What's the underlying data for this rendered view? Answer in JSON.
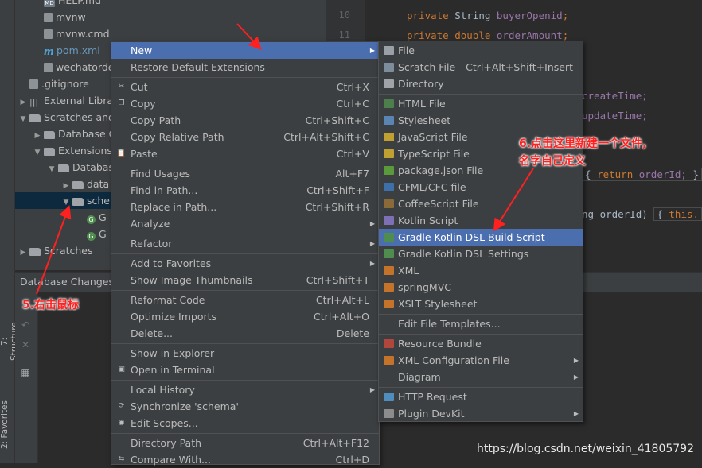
{
  "project_tree": [
    {
      "label": "HELP.md",
      "icon": "md",
      "indent": 1,
      "twisty": ""
    },
    {
      "label": "mvnw",
      "icon": "file",
      "indent": 1,
      "twisty": ""
    },
    {
      "label": "mvnw.cmd",
      "icon": "file",
      "indent": 1,
      "twisty": ""
    },
    {
      "label": "pom.xml",
      "icon": "m",
      "indent": 1,
      "twisty": "",
      "blue": true
    },
    {
      "label": "wechatorde",
      "icon": "file",
      "indent": 1,
      "twisty": ""
    },
    {
      "label": ".gitignore",
      "icon": "file",
      "indent": 0,
      "twisty": ""
    },
    {
      "label": "External Librar",
      "icon": "lib",
      "indent": 0,
      "twisty": "▶"
    },
    {
      "label": "Scratches and",
      "icon": "folder",
      "indent": 0,
      "twisty": "▼"
    },
    {
      "label": "Database C",
      "icon": "folder",
      "indent": 1,
      "twisty": "▶"
    },
    {
      "label": "Extensions",
      "icon": "folder",
      "indent": 1,
      "twisty": "▼"
    },
    {
      "label": "Databas",
      "icon": "folder",
      "indent": 2,
      "twisty": "▼"
    },
    {
      "label": "data",
      "icon": "folder",
      "indent": 3,
      "twisty": "▶"
    },
    {
      "label": "schen",
      "icon": "folder",
      "indent": 3,
      "twisty": "▼",
      "selected": true
    },
    {
      "label": "G",
      "icon": "g",
      "indent": 4,
      "twisty": ""
    },
    {
      "label": "G",
      "icon": "g",
      "indent": 4,
      "twisty": ""
    },
    {
      "label": "Scratches",
      "icon": "folder",
      "indent": 0,
      "twisty": "▶"
    }
  ],
  "side_tabs": {
    "structure": "7: Structure",
    "favorites": "2: Favorites"
  },
  "database_changes_label": "Database Changes",
  "line_numbers": [
    "10",
    "11"
  ],
  "code": {
    "private": "private",
    "string_type": "String",
    "double_type": "double",
    "buyer_openid": "buyerOpenid",
    "order_amount": "orderAmount",
    "create_time": "createTime;",
    "update_time": "updateTime;",
    "return_kw": "return",
    "order_id": "orderId;",
    "ng_order_id": "ng orderId)",
    "this_kw": "this."
  },
  "context_menu": [
    {
      "label": "New",
      "shortcut": "",
      "arrow": true,
      "hl": true,
      "icon": ""
    },
    {
      "label": "Restore Default Extensions",
      "shortcut": "",
      "icon": ""
    },
    {
      "sep": true
    },
    {
      "label": "Cut",
      "shortcut": "Ctrl+X",
      "icon": "scissors-icon"
    },
    {
      "label": "Copy",
      "shortcut": "Ctrl+C",
      "icon": "copy-icon"
    },
    {
      "label": "Copy Path",
      "shortcut": "Ctrl+Shift+C",
      "icon": ""
    },
    {
      "label": "Copy Relative Path",
      "shortcut": "Ctrl+Alt+Shift+C",
      "icon": ""
    },
    {
      "label": "Paste",
      "shortcut": "Ctrl+V",
      "icon": "paste-icon"
    },
    {
      "sep": true
    },
    {
      "label": "Find Usages",
      "shortcut": "Alt+F7",
      "icon": ""
    },
    {
      "label": "Find in Path...",
      "shortcut": "Ctrl+Shift+F",
      "icon": ""
    },
    {
      "label": "Replace in Path...",
      "shortcut": "Ctrl+Shift+R",
      "icon": ""
    },
    {
      "label": "Analyze",
      "shortcut": "",
      "arrow": true,
      "icon": ""
    },
    {
      "sep": true
    },
    {
      "label": "Refactor",
      "shortcut": "",
      "arrow": true,
      "icon": ""
    },
    {
      "sep": true
    },
    {
      "label": "Add to Favorites",
      "shortcut": "",
      "arrow": true,
      "icon": ""
    },
    {
      "label": "Show Image Thumbnails",
      "shortcut": "Ctrl+Shift+T",
      "icon": ""
    },
    {
      "sep": true
    },
    {
      "label": "Reformat Code",
      "shortcut": "Ctrl+Alt+L",
      "icon": ""
    },
    {
      "label": "Optimize Imports",
      "shortcut": "Ctrl+Alt+O",
      "icon": ""
    },
    {
      "label": "Delete...",
      "shortcut": "Delete",
      "icon": ""
    },
    {
      "sep": true
    },
    {
      "label": "Show in Explorer",
      "shortcut": "",
      "icon": ""
    },
    {
      "label": "Open in Terminal",
      "shortcut": "",
      "icon": "terminal-icon"
    },
    {
      "sep": true
    },
    {
      "label": "Local History",
      "shortcut": "",
      "arrow": true,
      "icon": ""
    },
    {
      "label": "Synchronize 'schema'",
      "shortcut": "",
      "icon": "sync-icon"
    },
    {
      "label": "Edit Scopes...",
      "shortcut": "",
      "icon": "scope-icon"
    },
    {
      "sep": true
    },
    {
      "label": "Directory Path",
      "shortcut": "Ctrl+Alt+F12",
      "icon": ""
    },
    {
      "label": "Compare With...",
      "shortcut": "Ctrl+D",
      "icon": "compare-icon"
    }
  ],
  "new_submenu": [
    {
      "label": "File",
      "shortcut": "",
      "icon": "file-icon",
      "color": "#9aa0a6"
    },
    {
      "label": "Scratch File",
      "shortcut": "Ctrl+Alt+Shift+Insert",
      "icon": "scratch-file-icon",
      "color": "#7d8d9c"
    },
    {
      "label": "Directory",
      "shortcut": "",
      "icon": "folder-icon",
      "color": "#a0a4a8"
    },
    {
      "sep": true
    },
    {
      "label": "HTML File",
      "shortcut": "",
      "icon": "html-file-icon",
      "color": "#4d7f4d"
    },
    {
      "label": "Stylesheet",
      "shortcut": "",
      "icon": "css-file-icon",
      "color": "#5a84b3"
    },
    {
      "label": "JavaScript File",
      "shortcut": "",
      "icon": "js-file-icon",
      "color": "#c0a030"
    },
    {
      "label": "TypeScript File",
      "shortcut": "",
      "icon": "ts-file-icon",
      "color": "#c0a030"
    },
    {
      "label": "package.json File",
      "shortcut": "",
      "icon": "package-json-icon",
      "color": "#5a9a3a"
    },
    {
      "label": "CFML/CFC file",
      "shortcut": "",
      "icon": "cfml-file-icon",
      "color": "#3d6fa8"
    },
    {
      "label": "CoffeeScript File",
      "shortcut": "",
      "icon": "coffeescript-file-icon",
      "color": "#8b6a3a"
    },
    {
      "label": "Kotlin Script",
      "shortcut": "",
      "icon": "kotlin-script-icon",
      "color": "#7f6fb5"
    },
    {
      "label": "Gradle Kotlin DSL Build Script",
      "shortcut": "",
      "icon": "gradle-icon",
      "color": "#4e8d4e",
      "hl": true
    },
    {
      "label": "Gradle Kotlin DSL Settings",
      "shortcut": "",
      "icon": "gradle-icon",
      "color": "#4e8d4e"
    },
    {
      "label": "XML",
      "shortcut": "",
      "icon": "xml-file-icon",
      "color": "#c4742a"
    },
    {
      "label": "springMVC",
      "shortcut": "",
      "icon": "xml-file-icon",
      "color": "#c4742a"
    },
    {
      "label": "XSLT Stylesheet",
      "shortcut": "",
      "icon": "xslt-file-icon",
      "color": "#c4742a"
    },
    {
      "sep": true
    },
    {
      "label": "Edit File Templates...",
      "shortcut": "",
      "icon": ""
    },
    {
      "sep": true
    },
    {
      "label": "Resource Bundle",
      "shortcut": "",
      "icon": "resource-bundle-icon",
      "color": "#b0463c"
    },
    {
      "label": "XML Configuration File",
      "shortcut": "",
      "icon": "xml-config-icon",
      "color": "#c4742a",
      "arrow": true
    },
    {
      "label": "Diagram",
      "shortcut": "",
      "icon": "",
      "arrow": true
    },
    {
      "sep": true
    },
    {
      "label": "HTTP Request",
      "shortcut": "",
      "icon": "http-request-icon",
      "color": "#4f8dbf"
    },
    {
      "label": "Plugin DevKit",
      "shortcut": "",
      "icon": "plugin-devkit-icon",
      "color": "#8c8c8c",
      "arrow": true
    }
  ],
  "annotations": {
    "right_click": "5.右击鼠标",
    "new_file_line1": "6.点击这里新建一个文件,",
    "new_file_line2": "名字自己定义"
  },
  "watermark": "https://blog.csdn.net/weixin_41805792",
  "colors": {
    "accent": "#4b6eaf",
    "annotation": "#ff2020"
  }
}
